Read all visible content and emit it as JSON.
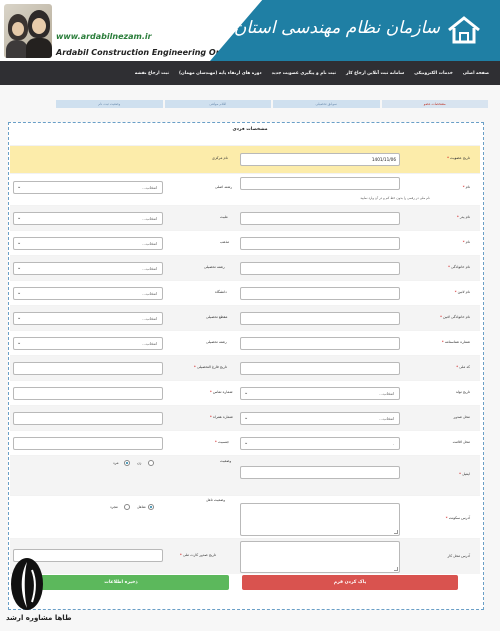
{
  "header": {
    "org_name_fa": "سازمان نظام مهندسی استان اردبیل",
    "url": "www.ardabilnezam.ir",
    "org_name_en": "Ardabil Construction Engineering Organization"
  },
  "nav": {
    "items": [
      "صفحه اصلی",
      "خدمات الکترونیکی",
      "سامانه ثبت آنلاین ارجاع کار",
      "ثبت نام و پیگیری عضویت جدید",
      "دوره های ارتقاء پایه (مهندسان مهمان)",
      "ثبت ارجاع نقشه"
    ]
  },
  "steps": [
    "مشخصات عضو",
    "سوابق تحصیلی",
    "اقلام مولفی",
    "وضعیت ثبت نام"
  ],
  "form": {
    "title": "مشخصات فردی",
    "date_label": "تاریخ عضویت",
    "date_value": "1401/11/06",
    "ref_label": "نام مرکزی",
    "name_label": "نام",
    "name_hint": "نام ملی در رقمی را بدون خط کم و در آن وارد نمایید",
    "major_label": "رشته اصلی",
    "father_label": "نام پدر",
    "nationality_label": "ملیت",
    "firstname_fa_label": "نام",
    "religion_label": "مذهب",
    "lastname_fa_label": "نام خانوادگی",
    "edu_major_label": "رشته تحصیلی",
    "firstname_en_label": "نام لاتین",
    "university_label": "دانشگاه",
    "lastname_en_label": "نام خانوادگی لاتین",
    "edu_level_label": "مقطع تحصیلی",
    "id_no_label": "شماره شناسنامه",
    "edu_field_label": "رشته تحصیلی",
    "national_code_label": "کد ملی",
    "grad_date_label": "تاریخ فارغ التحصیلی",
    "birth_date_label": "تاریخ تولد",
    "phone_label": "شماره تماس",
    "birth_place_label": "محل تولد",
    "mobile_label": "شماره همراه",
    "issue_place_label": "محل صدور",
    "gender_label": "جنسیت",
    "residence_label": "محل اقامت",
    "marital_label": "وضعیت",
    "email_label": "ایمیل",
    "married_status_label": "وضعیت تاهل",
    "address_label": "آدرس سکونت",
    "work_address_label": "آدرس محل کار",
    "foreign_date_label": "تاریخ صدور کارت ملی",
    "select_placeholder": "انتخاب...",
    "dot_value": ".",
    "radio_male": "مرد",
    "radio_female": "زن",
    "radio_single": "مجرد",
    "radio_married": "متاهل",
    "btn_reset": "پاک کردن فرم",
    "btn_save": "ذخیره اطلاعات"
  },
  "watermark": {
    "text": "طاها مشاوره ارشد"
  }
}
